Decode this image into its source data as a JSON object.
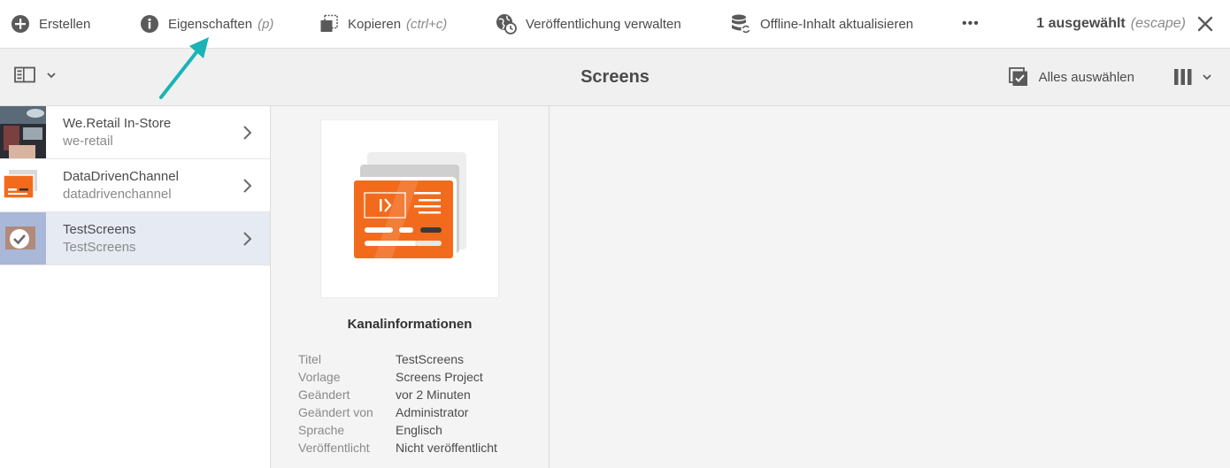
{
  "actions": {
    "create": {
      "label": "Erstellen"
    },
    "properties": {
      "label": "Eigenschaften",
      "hint": "(p)"
    },
    "copy": {
      "label": "Kopieren",
      "hint": "(ctrl+c)"
    },
    "publish": {
      "label": "Veröffentlichung verwalten"
    },
    "offline": {
      "label": "Offline-Inhalt aktualisieren"
    },
    "more": {
      "label": "•••"
    }
  },
  "selection": {
    "label": "1 ausgewählt",
    "hint": "(escape)"
  },
  "header": {
    "title": "Screens",
    "select_all_label": "Alles auswählen"
  },
  "list": [
    {
      "title": "We.Retail In-Store",
      "subtitle": "we-retail",
      "selected": false
    },
    {
      "title": "DataDrivenChannel",
      "subtitle": "datadrivenchannel",
      "selected": false
    },
    {
      "title": "TestScreens",
      "subtitle": "TestScreens",
      "selected": true
    }
  ],
  "details": {
    "heading": "Kanalinformationen",
    "fields": [
      {
        "label": "Titel",
        "value": "TestScreens"
      },
      {
        "label": "Vorlage",
        "value": "Screens Project"
      },
      {
        "label": "Geändert",
        "value": "vor 2 Minuten"
      },
      {
        "label": "Geändert von",
        "value": "Administrator"
      },
      {
        "label": "Sprache",
        "value": "Englisch"
      },
      {
        "label": "Veröffentlicht",
        "value": "Nicht veröffentlicht"
      }
    ]
  },
  "colors": {
    "accent_orange": "#f26b1d",
    "selection_bg": "#e5eaf3",
    "annotation_arrow": "#1bb3b5"
  }
}
